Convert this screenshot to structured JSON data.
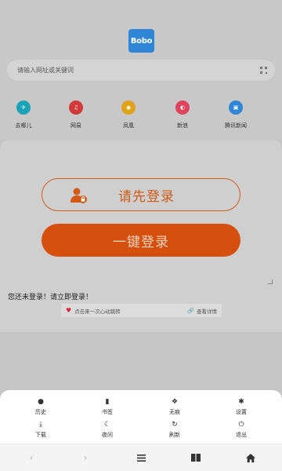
{
  "home": {
    "logo_text": "Bobo",
    "search_placeholder": "请输入网址或关键词",
    "quick_links": [
      {
        "label": "去哪儿",
        "icon": "plane-icon",
        "color": "#1aa3b8"
      },
      {
        "label": "网易",
        "icon": "music-icon",
        "color": "#d23a3a"
      },
      {
        "label": "凤凰",
        "icon": "phoenix-icon",
        "color": "#e0a21b"
      },
      {
        "label": "新浪",
        "icon": "weibo-icon",
        "color": "#e0445d"
      },
      {
        "label": "腾讯新闻",
        "icon": "news-icon",
        "color": "#2f86d6"
      }
    ]
  },
  "login": {
    "primary_label": "请先登录",
    "one_click_label": "一键登录",
    "notice": "您还未登录！请立即登录！",
    "promo_text": "点击来一次心动跳转",
    "promo_link": "查看详情",
    "accent_color": "#d5500f"
  },
  "menu": {
    "items": [
      {
        "label": "历史",
        "icon": "history-icon"
      },
      {
        "label": "书签",
        "icon": "bookmark-icon"
      },
      {
        "label": "无痕",
        "icon": "paw-icon"
      },
      {
        "label": "设置",
        "icon": "gear-icon"
      },
      {
        "label": "下载",
        "icon": "download-icon"
      },
      {
        "label": "夜间",
        "icon": "moon-icon"
      },
      {
        "label": "刷新",
        "icon": "refresh-icon"
      },
      {
        "label": "退出",
        "icon": "power-icon"
      }
    ]
  },
  "navbar": {
    "icons": [
      "back-icon",
      "forward-icon",
      "menu-icon",
      "book-icon",
      "home-icon"
    ]
  }
}
